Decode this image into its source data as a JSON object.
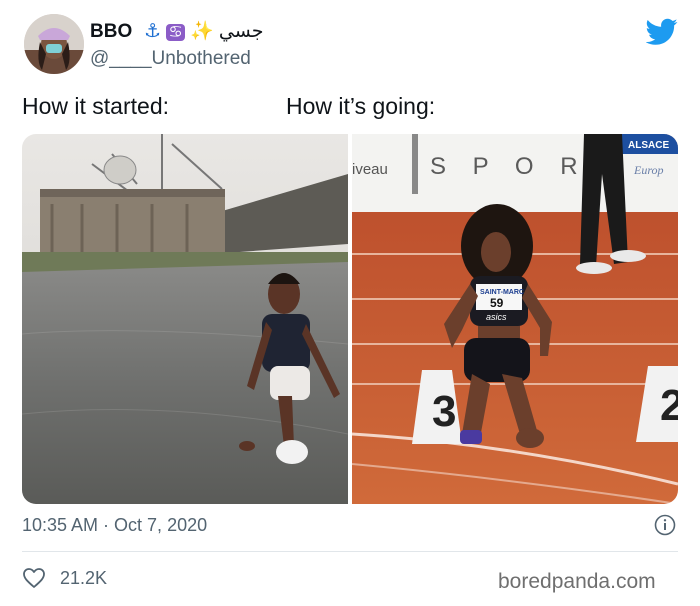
{
  "tweet": {
    "display_name": "BBO",
    "name_arabic": "جسي",
    "handle": "@____Unbothered",
    "caption_left": "How it started:",
    "caption_right": "How it’s going:",
    "timestamp": "10:35 AM · Oct 7, 2020",
    "likes": "21.2K"
  },
  "photo_right_text": {
    "banner_fragment": "iveau",
    "banner_letters": "S P O R",
    "sponsor": "ALSACE",
    "sponsor_sub": "Europ",
    "bib_name": "SAINT-MARC",
    "bib_number": "59",
    "brand": "asics",
    "lane_left": "3",
    "lane_right": "2"
  },
  "watermark": "boredpanda.com",
  "colors": {
    "twitter_blue": "#1d9bf0",
    "track": "#c4562f",
    "muted": "#536471"
  },
  "icons": {
    "verified_like": "heart-icon",
    "info": "info-icon",
    "brand": "twitter-bird-icon"
  }
}
